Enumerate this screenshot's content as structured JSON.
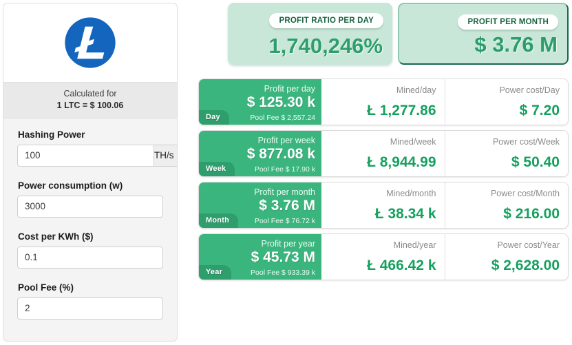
{
  "sidebar": {
    "logo": {
      "icon": "litecoin-logo-icon",
      "circle_color": "#1465bd",
      "glyph": "Ł"
    },
    "calculated_for_label": "Calculated for",
    "rate_text": "1 LTC = $ 100.06",
    "fields": [
      {
        "label": "Hashing Power",
        "value": "100",
        "placeholder": "100",
        "unit": "TH/s",
        "unit_icon": "chevron-down-icon",
        "has_unit": true
      },
      {
        "label": "Power consumption (w)",
        "value": "3000",
        "placeholder": "3000",
        "has_unit": false
      },
      {
        "label": "Cost per KWh ($)",
        "value": "0.1",
        "placeholder": "0.1",
        "has_unit": false
      },
      {
        "label": "Pool Fee (%)",
        "value": "2",
        "placeholder": "2",
        "has_unit": false
      }
    ]
  },
  "summary_cards": [
    {
      "pill": "PROFIT RATIO PER DAY",
      "value": "1,740,246%"
    },
    {
      "pill": "PROFIT PER MONTH",
      "value": "$ 3.76 M"
    }
  ],
  "rows": [
    {
      "badge": "Day",
      "profit_label": "Profit per day",
      "profit_value": "$ 125.30 k",
      "pool_fee": "Pool Fee $ 2,557.24",
      "mined_label": "Mined/day",
      "mined_value": "Ł 1,277.86",
      "power_label": "Power cost/Day",
      "power_value": "$ 7.20"
    },
    {
      "badge": "Week",
      "profit_label": "Profit per week",
      "profit_value": "$ 877.08 k",
      "pool_fee": "Pool Fee $ 17.90 k",
      "mined_label": "Mined/week",
      "mined_value": "Ł 8,944.99",
      "power_label": "Power cost/Week",
      "power_value": "$ 50.40"
    },
    {
      "badge": "Month",
      "profit_label": "Profit per month",
      "profit_value": "$ 3.76 M",
      "pool_fee": "Pool Fee $ 76.72 k",
      "mined_label": "Mined/month",
      "mined_value": "Ł 38.34 k",
      "power_label": "Power cost/Month",
      "power_value": "$ 216.00"
    },
    {
      "badge": "Year",
      "profit_label": "Profit per year",
      "profit_value": "$ 45.73 M",
      "pool_fee": "Pool Fee $ 933.39 k",
      "mined_label": "Mined/year",
      "mined_value": "Ł 466.42 k",
      "power_label": "Power cost/Year",
      "power_value": "$ 2,628.00"
    }
  ],
  "colors": {
    "brand_green": "#3bb57e",
    "badge_green": "#2f9e6d",
    "value_green": "#15a05f",
    "card_bg": "#c9e7d8",
    "card_border": "#19694a",
    "litecoin_blue": "#1465bd"
  }
}
